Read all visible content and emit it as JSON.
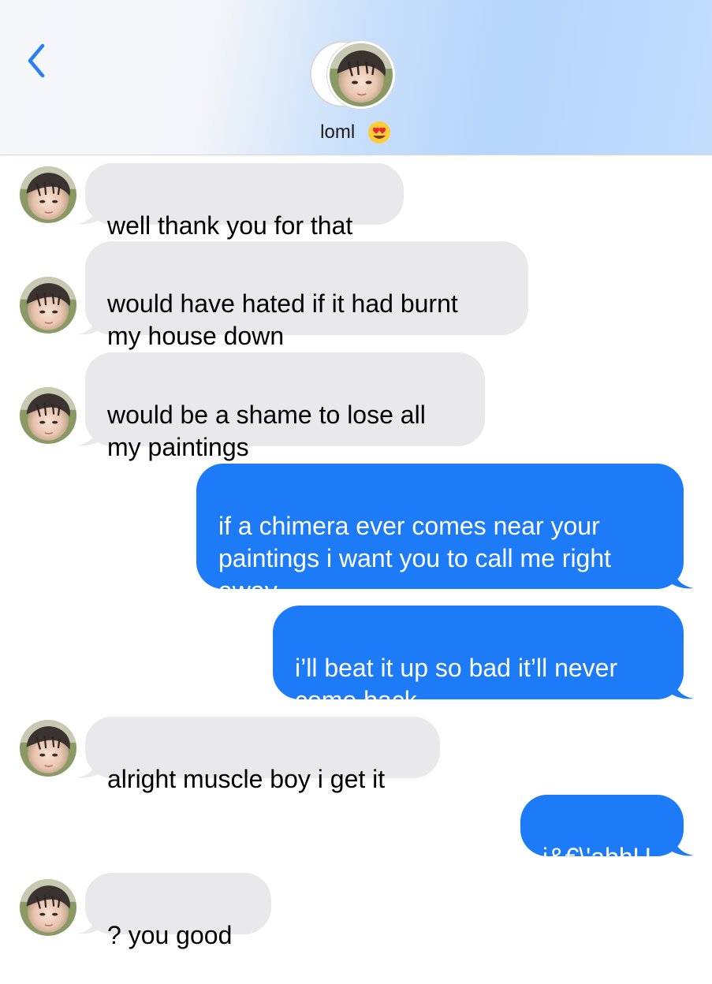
{
  "header": {
    "contact_name": "loml",
    "contact_emoji": "😍",
    "back_icon": "chevron-left-icon"
  },
  "colors": {
    "incoming_bubble": "#e9e9eb",
    "outgoing_bubble": "#1e7bf7",
    "accent": "#2b7cf6"
  },
  "messages": [
    {
      "direction": "incoming",
      "text": "well thank you for that"
    },
    {
      "direction": "incoming",
      "text": "would have hated if it had burnt\nmy house down"
    },
    {
      "direction": "incoming",
      "text": "would be a shame to lose all\nmy paintings"
    },
    {
      "direction": "outgoing",
      "text": "if a chimera ever comes near your\npaintings i want you to call me right\naway"
    },
    {
      "direction": "outgoing",
      "text": "i’ll beat it up so bad it’ll never\ncome back"
    },
    {
      "direction": "incoming",
      "text": "alright muscle boy i get it"
    },
    {
      "direction": "outgoing",
      "text": "i&€\\'abhU"
    },
    {
      "direction": "incoming",
      "text": "? you good"
    }
  ]
}
